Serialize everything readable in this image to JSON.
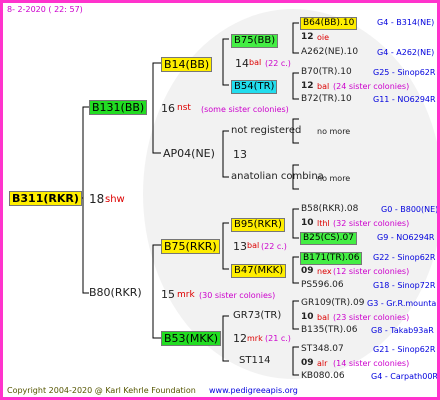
{
  "header_date": "8-  2-2020 ( 22: 57)",
  "footer": {
    "copyright": "Copyright 2004-2020 @ Karl Kehrle Foundation",
    "website": "www.pedigreeapis.org"
  },
  "root": {
    "id": "B311(RKR)",
    "num": "18",
    "tag": "shw"
  },
  "gen1": {
    "top": {
      "id": "B131(BB)",
      "num": "16",
      "tag": "nst",
      "note": "(some sister colonies)"
    },
    "bottom": {
      "id": "B80(RKR)",
      "num": "15",
      "tag": "mrk",
      "note": "(30 sister colonies)"
    }
  },
  "gen2": {
    "a": {
      "id": "B14(BB)",
      "num": "14",
      "tag": "bal",
      "note": "(22 c.)"
    },
    "b": {
      "id": "AP04(NE)",
      "num": "13"
    },
    "c": {
      "id": "B75(RKR)",
      "num": "13",
      "tag": "bal",
      "note": "(22 c.)"
    },
    "d": {
      "id": "B53(MKK)",
      "num": "12",
      "tag": "mrk",
      "note": "(21 c.)"
    }
  },
  "gen3": {
    "a": {
      "id": "B75(BB)"
    },
    "b": {
      "id": "B54(TR)"
    },
    "c": {
      "id": "not registered"
    },
    "d": {
      "id": "anatolian combina"
    },
    "e": {
      "id": "B95(RKR)"
    },
    "f": {
      "id": "B47(MKK)"
    },
    "g": {
      "id": "GR73(TR)"
    },
    "h": {
      "id": "ST114"
    }
  },
  "gen4": {
    "r1": {
      "id": "B64(BB).10",
      "ref": "G4 - B314(NE)"
    },
    "r1n": {
      "num": "12",
      "tag": "oie"
    },
    "r2": {
      "id": "A262(NE).10",
      "ref": "G4 - A262(NE)"
    },
    "r3": {
      "id": "B70(TR).10",
      "ref": "G25 - Sinop62R"
    },
    "r3n": {
      "num": "12",
      "tag": "bal",
      "note": "(24 sister colonies)"
    },
    "r4": {
      "id": "B72(TR).10",
      "ref": "G11 - NO6294R"
    },
    "r5": {
      "text": "no more"
    },
    "r6": {
      "text": "no more"
    },
    "r7": {
      "id": "B58(RKR).08",
      "ref": "G0 - B800(NE)"
    },
    "r7n": {
      "num": "10",
      "tag": "lthl",
      "note": "(32 sister colonies)"
    },
    "r8": {
      "id": "B25(CS).07",
      "ref": "G9 - NO6294R"
    },
    "r9": {
      "id": "B171(TR).06",
      "ref": "G22 - Sinop62R"
    },
    "r9n": {
      "num": "09",
      "tag": "nex",
      "note": "(12 sister colonies)"
    },
    "r10": {
      "id": "PS596.06",
      "ref": "G18 - Sinop72R"
    },
    "r11": {
      "id": "GR109(TR).09",
      "ref": "G3 - Gr.R.mounta"
    },
    "r11n": {
      "num": "10",
      "tag": "bal",
      "note": "(23 sister colonies)"
    },
    "r12": {
      "id": "B135(TR).06",
      "ref": "G8 - Takab93aR"
    },
    "r13": {
      "id": "ST348.07",
      "ref": "G21 - Sinop62R"
    },
    "r13n": {
      "num": "09",
      "tag": "alr",
      "note": "(14 sister colonies)"
    },
    "r14": {
      "id": "KB080.06",
      "ref": "G4 - Carpath00R"
    }
  }
}
